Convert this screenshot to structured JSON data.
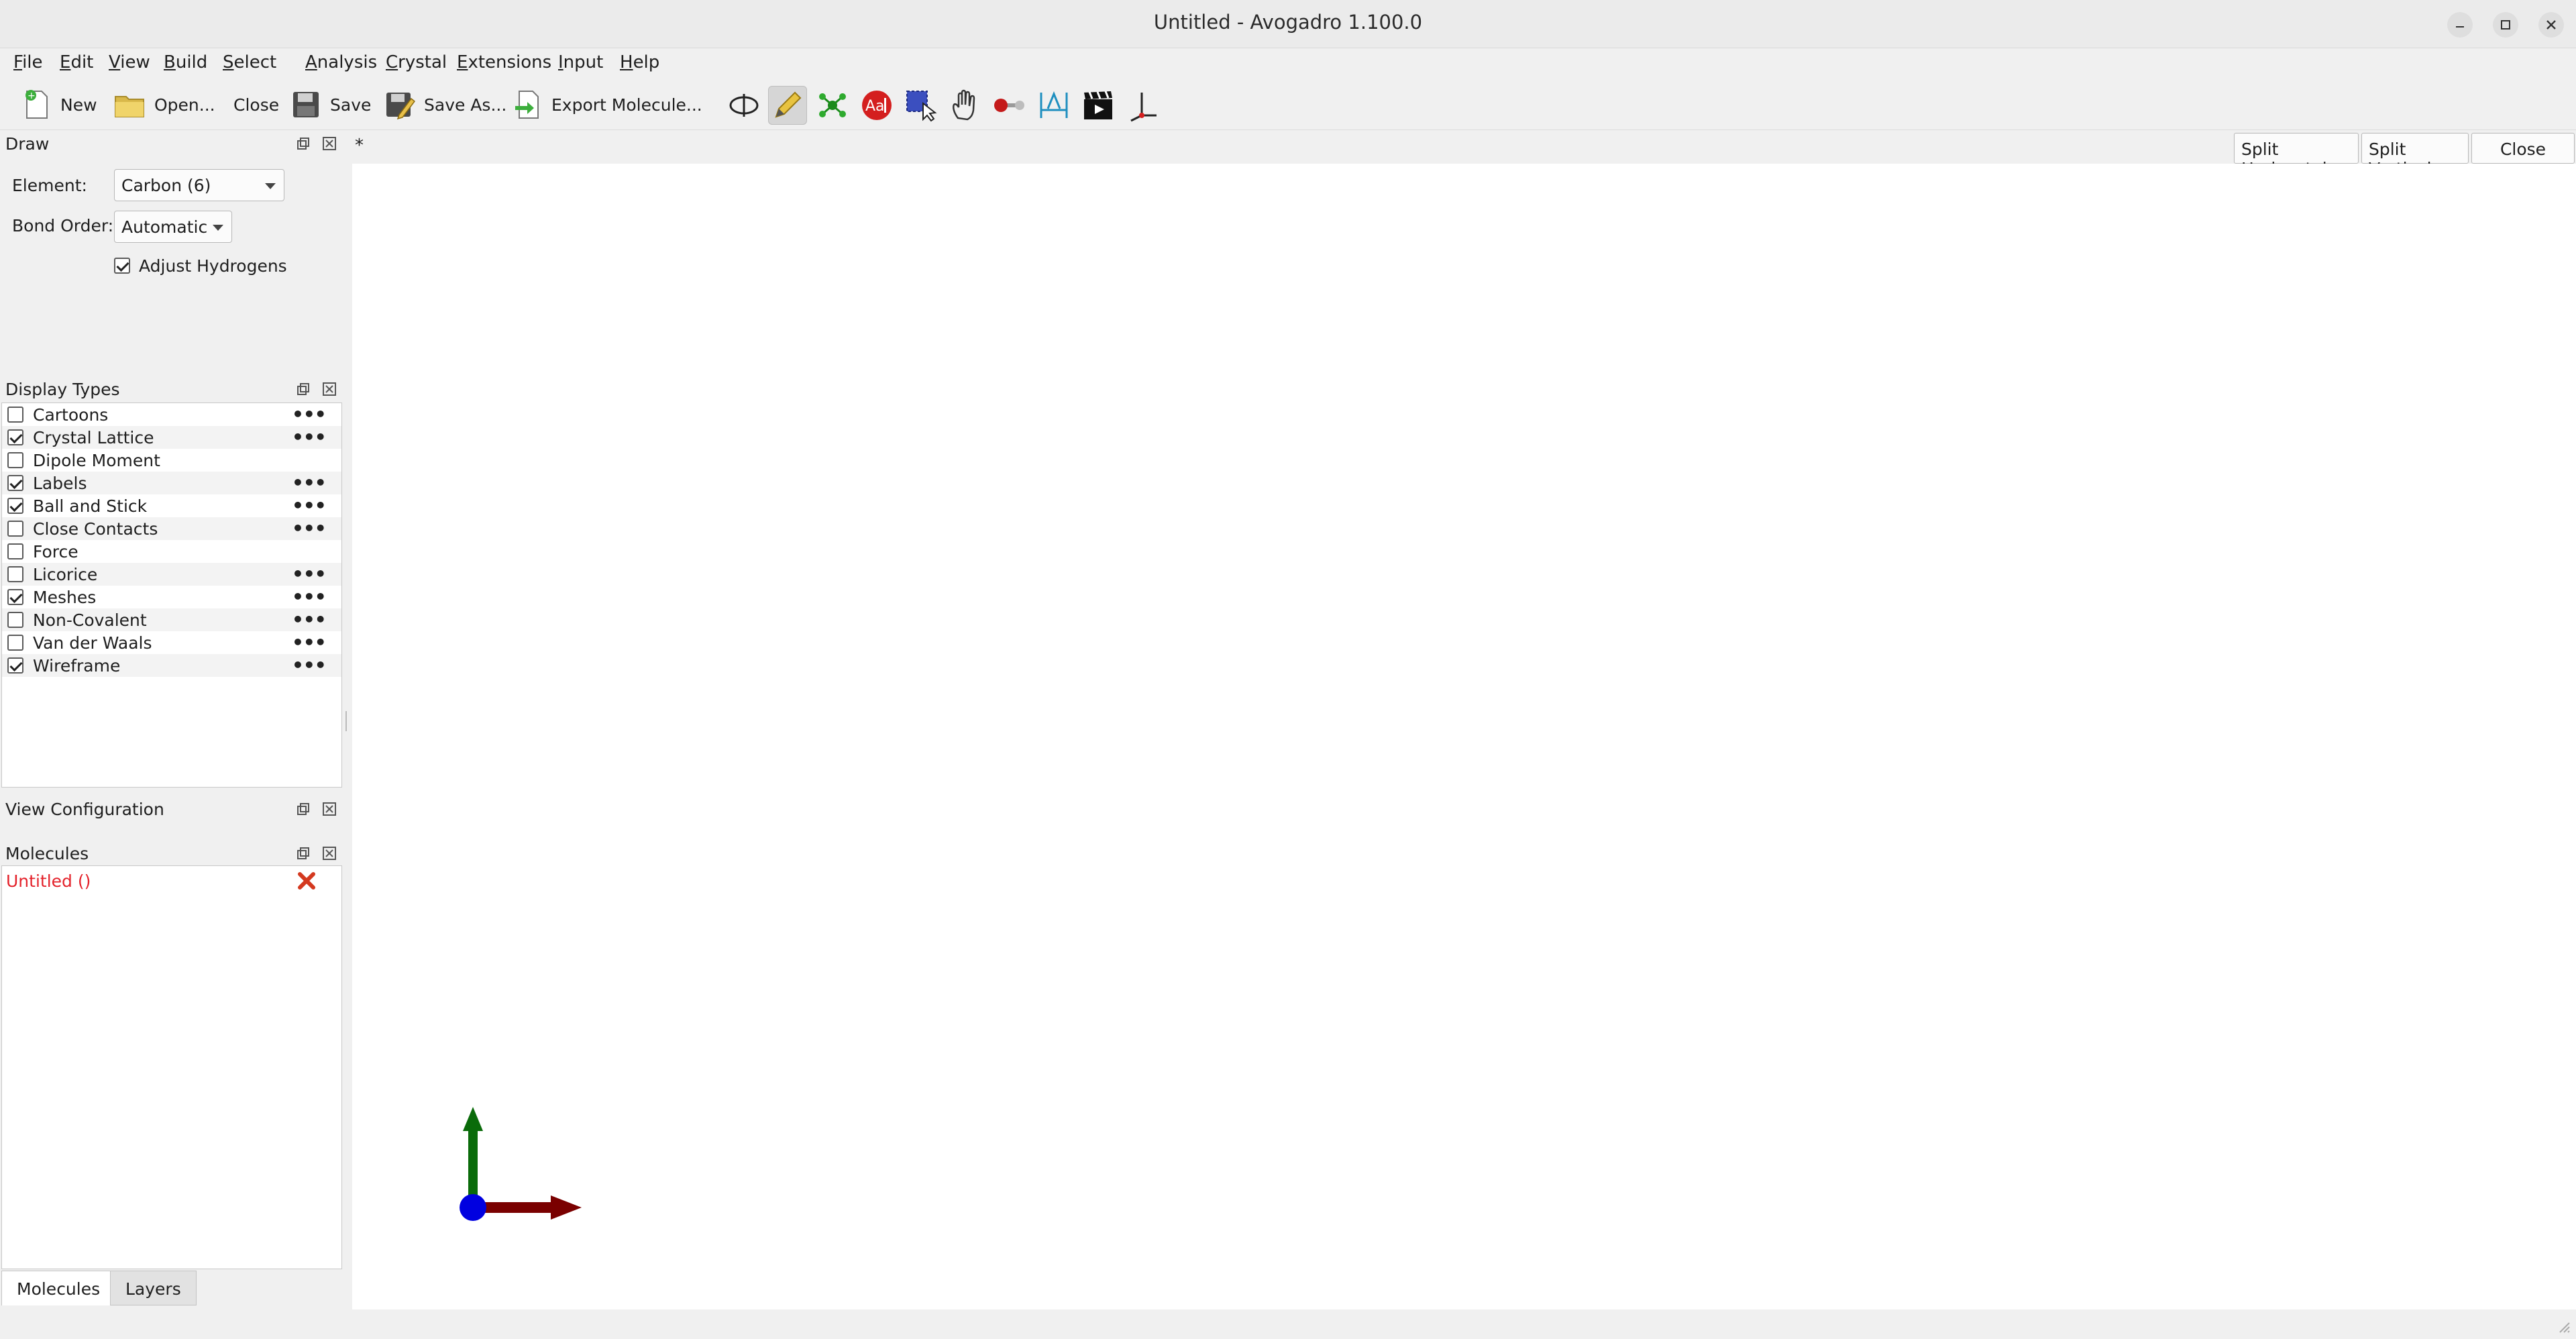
{
  "window": {
    "title": "Untitled - Avogadro 1.100.0"
  },
  "menu": {
    "items": [
      {
        "pre": "",
        "ul": "F",
        "post": "ile"
      },
      {
        "pre": "",
        "ul": "E",
        "post": "dit"
      },
      {
        "pre": "",
        "ul": "V",
        "post": "iew"
      },
      {
        "pre": "",
        "ul": "B",
        "post": "uild"
      },
      {
        "pre": "",
        "ul": "S",
        "post": "elect"
      },
      {
        "pre": "",
        "ul": "A",
        "post": "nalysis"
      },
      {
        "pre": "",
        "ul": "C",
        "post": "rystal"
      },
      {
        "pre": "",
        "ul": "E",
        "post": "xtensions"
      },
      {
        "pre": "",
        "ul": "I",
        "post": "nput"
      },
      {
        "pre": "",
        "ul": "H",
        "post": "elp"
      }
    ]
  },
  "toolbar": {
    "new_label": "New",
    "open_label": "Open...",
    "close_label": "Close",
    "save_label": "Save",
    "save_as_label": "Save As...",
    "export_label": "Export Molecule..."
  },
  "draw_panel": {
    "title": "Draw",
    "element_label": "Element:",
    "element_value": "Carbon (6)",
    "bond_order_label": "Bond Order:",
    "bond_order_value": "Automatic",
    "adjust_hydrogens_label": "Adjust Hydrogens",
    "adjust_hydrogens_checked": true
  },
  "display_types": {
    "title": "Display Types",
    "items": [
      {
        "name": "Cartoons",
        "checked": false,
        "has_settings": true
      },
      {
        "name": "Crystal Lattice",
        "checked": true,
        "has_settings": true
      },
      {
        "name": "Dipole Moment",
        "checked": false,
        "has_settings": false
      },
      {
        "name": "Labels",
        "checked": true,
        "has_settings": true
      },
      {
        "name": "Ball and Stick",
        "checked": true,
        "has_settings": true
      },
      {
        "name": "Close Contacts",
        "checked": false,
        "has_settings": true
      },
      {
        "name": "Force",
        "checked": false,
        "has_settings": false
      },
      {
        "name": "Licorice",
        "checked": false,
        "has_settings": true
      },
      {
        "name": "Meshes",
        "checked": true,
        "has_settings": true
      },
      {
        "name": "Non-Covalent",
        "checked": false,
        "has_settings": true
      },
      {
        "name": "Van der Waals",
        "checked": false,
        "has_settings": true
      },
      {
        "name": "Wireframe",
        "checked": true,
        "has_settings": true
      }
    ]
  },
  "view_config": {
    "title": "View Configuration"
  },
  "molecules": {
    "title": "Molecules",
    "items": [
      {
        "name": "Untitled ()"
      }
    ]
  },
  "bottom_tabs": {
    "molecules": "Molecules",
    "layers": "Layers"
  },
  "viewport": {
    "tab_marker": "*",
    "split_horizontal": "Split Horizontal",
    "split_vertical": "Split Vertical",
    "close": "Close"
  },
  "colors": {
    "axis_x": "#7a0000",
    "axis_y": "#0a6b0a",
    "axis_z": "#0000e0",
    "molecule_active": "#e4222b"
  }
}
